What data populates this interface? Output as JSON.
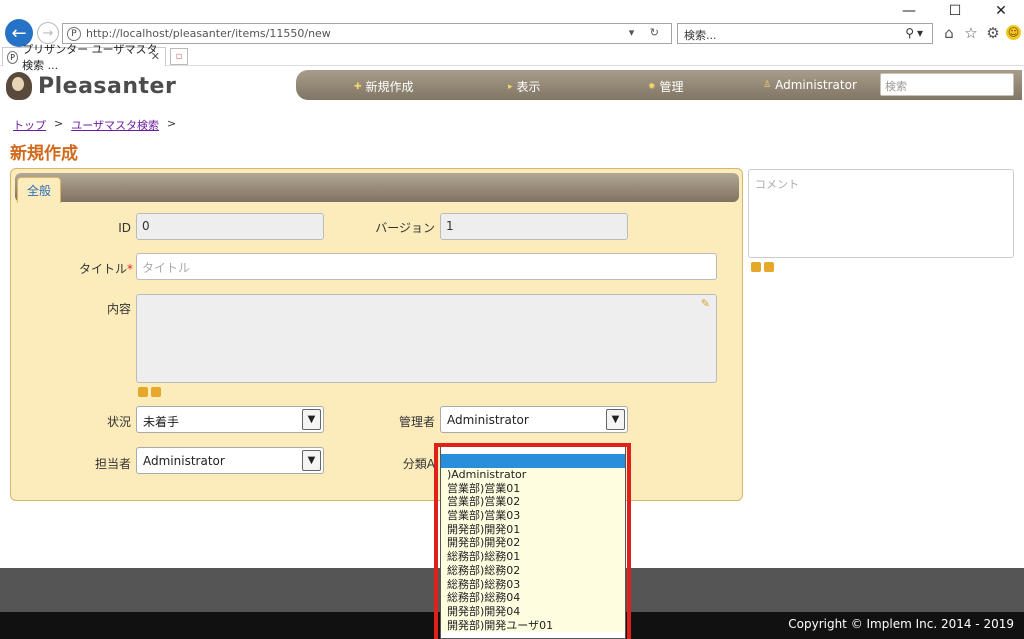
{
  "browser": {
    "url": "http://localhost/pleasanter/items/11550/new",
    "url_host": "localhost",
    "search_placeholder": "検索...",
    "tab_title": "プリザンター ユーザマスタ検索 ...",
    "window_controls": [
      "minimize",
      "maximize",
      "close"
    ]
  },
  "app": {
    "logo_text": "Pleasanter",
    "nav": {
      "new": "新規作成",
      "view": "表示",
      "manage": "管理",
      "user": "Administrator",
      "search_placeholder": "検索"
    }
  },
  "breadcrumb": {
    "top": "トップ",
    "sep": ">",
    "user_search": "ユーザマスタ検索"
  },
  "page_title": "新規作成",
  "form": {
    "tab_general": "全般",
    "id_label": "ID",
    "id_value": "0",
    "version_label": "バージョン",
    "version_value": "1",
    "title_label": "タイトル",
    "title_required": "*",
    "title_placeholder": "タイトル",
    "body_label": "内容",
    "status_label": "状況",
    "status_value": "未着手",
    "manager_label": "管理者",
    "manager_value": "Administrator",
    "owner_label": "担当者",
    "owner_value": "Administrator",
    "class_label": "分類A"
  },
  "comment_placeholder": "コメント",
  "dropdown": {
    "items": [
      ")Administrator",
      "営業部)営業01",
      "営業部)営業02",
      "営業部)営業03",
      "開発部)開発01",
      "開発部)開発02",
      "総務部)総務01",
      "総務部)総務02",
      "総務部)総務03",
      "総務部)総務04",
      "開発部)開発04",
      "開発部)開発ユーザ01"
    ]
  },
  "footer": {
    "copyright": "Copyright © Implem Inc. 2014 - 2019"
  }
}
